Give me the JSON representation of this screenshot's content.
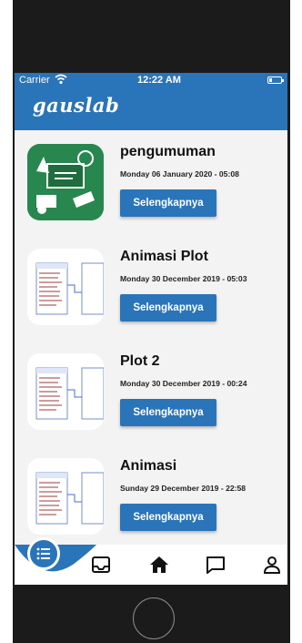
{
  "status_bar": {
    "carrier": "Carrier",
    "time": "12:22 AM"
  },
  "header": {
    "brand": "gauslab"
  },
  "posts": [
    {
      "title": "pengumuman",
      "date": "Monday 06 January 2020 - 05:08",
      "button": "Selengkapnya",
      "thumbnail": "school-classroom-icon"
    },
    {
      "title": "Animasi Plot",
      "date": "Monday 30 December 2019 - 05:03",
      "button": "Selengkapnya",
      "thumbnail": "database-diagram"
    },
    {
      "title": "Plot 2",
      "date": "Monday 30 December 2019 - 00:24",
      "button": "Selengkapnya",
      "thumbnail": "database-diagram"
    },
    {
      "title": "Animasi",
      "date": "Sunday 29 December 2019 - 22:58",
      "button": "Selengkapnya",
      "thumbnail": "database-diagram"
    }
  ],
  "tabbar": {
    "items": [
      "menu-icon",
      "inbox-icon",
      "home-icon",
      "chat-icon",
      "profile-icon"
    ]
  },
  "colors": {
    "primary": "#2a74b9",
    "background": "#f3f3f3",
    "thumbnail_green": "#27874f",
    "bezel": "#1b1b1b"
  }
}
